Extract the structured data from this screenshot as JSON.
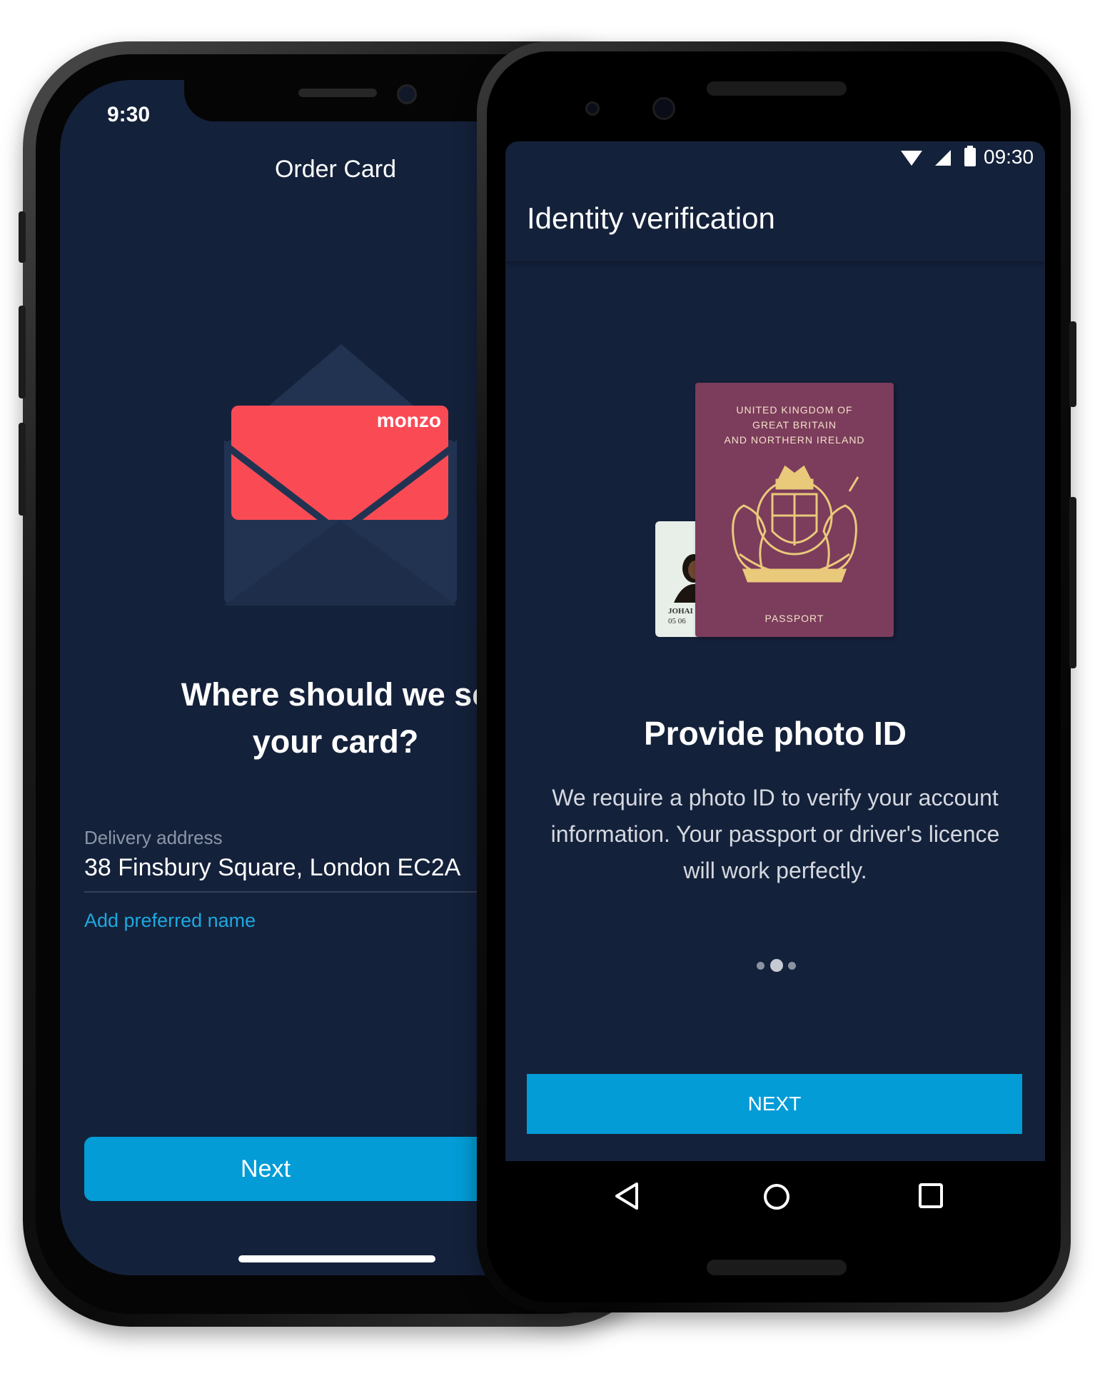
{
  "ios": {
    "time": "9:30",
    "title": "Order Card",
    "card_brand": "monzo",
    "headline_line1": "Where should we se",
    "headline_line2": "your card?",
    "delivery_label": "Delivery address",
    "delivery_value": "38 Finsbury Square, London EC2A",
    "add_name_link": "Add preferred name",
    "next_button": "Next"
  },
  "android": {
    "status_time": "09:30",
    "status_icons": [
      "wifi-icon",
      "signal-icon",
      "battery-icon"
    ],
    "app_title": "Identity verification",
    "passport": {
      "country_line1": "UNITED KINGDOM OF",
      "country_line2": "GREAT BRITAIN",
      "country_line3": "AND NORTHERN IRELAND",
      "label": "PASSPORT"
    },
    "id_card": {
      "name": "JOHAI",
      "date": "05 06"
    },
    "headline": "Provide photo ID",
    "body": "We require a photo ID to verify your account information. Your passport or driver's licence will work perfectly.",
    "pager": {
      "count": 3,
      "active": 2
    },
    "next_button": "NEXT",
    "nav": [
      "back-icon",
      "home-icon",
      "recents-icon"
    ]
  },
  "colors": {
    "screen_bg": "#14213a",
    "accent": "#039cd6",
    "monzo_coral": "#fa4b55",
    "envelope": "#223352",
    "passport": "#7c3c5c"
  }
}
